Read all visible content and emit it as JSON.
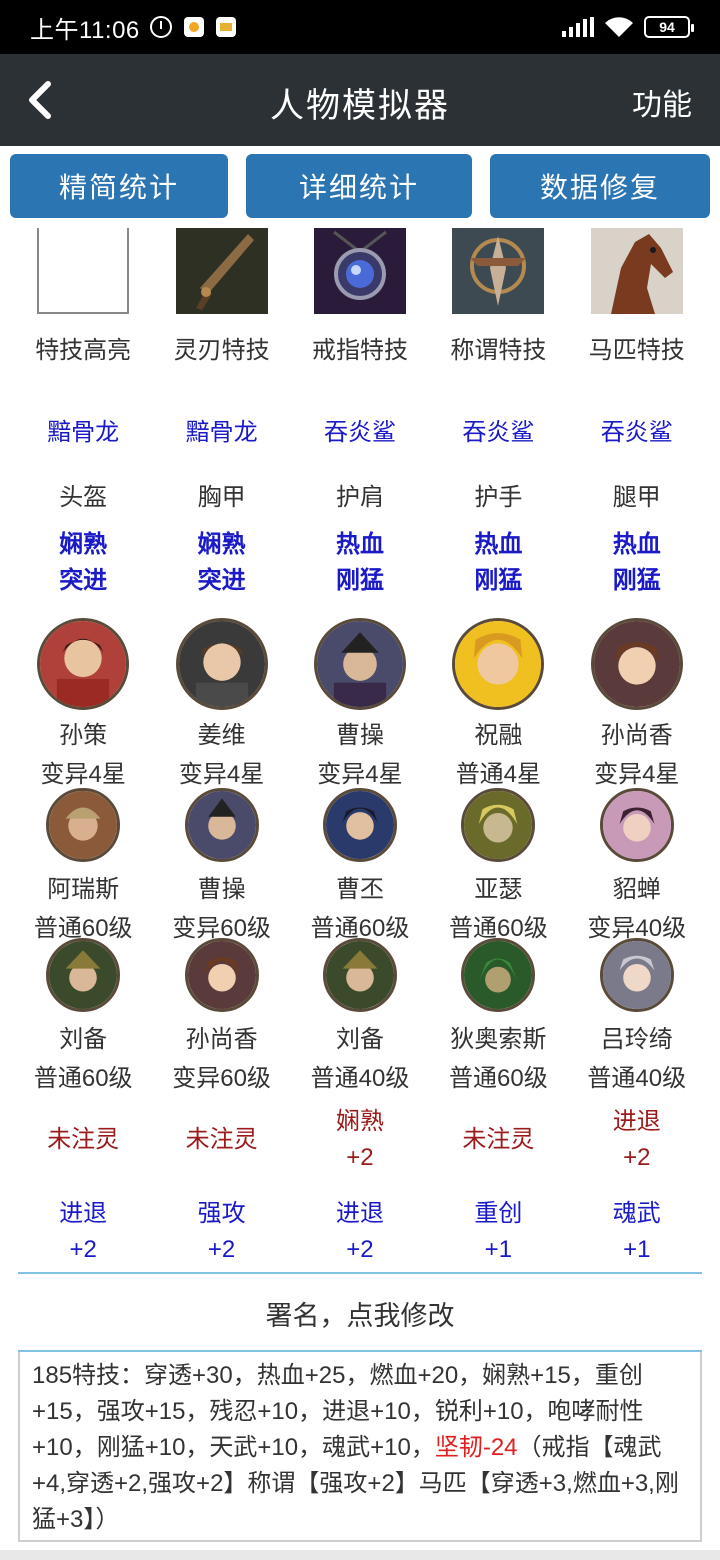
{
  "status_bar": {
    "time": "上午11:06",
    "battery": "94"
  },
  "header": {
    "title": "人物模拟器",
    "func": "功能"
  },
  "top_buttons": [
    "精简统计",
    "详细统计",
    "数据修复"
  ],
  "skills": [
    {
      "label": "特技高亮",
      "icon": "blank-frame"
    },
    {
      "label": "灵刃特技",
      "icon": "blade-icon"
    },
    {
      "label": "戒指特技",
      "icon": "ring-icon"
    },
    {
      "label": "称谓特技",
      "icon": "emblem-icon"
    },
    {
      "label": "马匹特技",
      "icon": "horse-icon"
    }
  ],
  "equip_sets": [
    "黯骨龙",
    "黯骨龙",
    "吞炎鲨",
    "吞炎鲨",
    "吞炎鲨"
  ],
  "equip_slots": [
    "头盔",
    "胸甲",
    "护肩",
    "护手",
    "腿甲"
  ],
  "equip_skills": [
    [
      "娴熟",
      "突进"
    ],
    [
      "娴熟",
      "突进"
    ],
    [
      "热血",
      "刚猛"
    ],
    [
      "热血",
      "刚猛"
    ],
    [
      "热血",
      "刚猛"
    ]
  ],
  "main_heroes": [
    {
      "name": "孙策",
      "level": "变异4星",
      "icon": "portrait-icon"
    },
    {
      "name": "姜维",
      "level": "变异4星",
      "icon": "portrait-icon"
    },
    {
      "name": "曹操",
      "level": "变异4星",
      "icon": "portrait-icon"
    },
    {
      "name": "祝融",
      "level": "普通4星",
      "icon": "portrait-icon"
    },
    {
      "name": "孙尚香",
      "level": "变异4星",
      "icon": "portrait-icon"
    }
  ],
  "support_row1": [
    {
      "name": "阿瑞斯",
      "level": "普通60级"
    },
    {
      "name": "曹操",
      "level": "变异60级"
    },
    {
      "name": "曹丕",
      "level": "普通60级"
    },
    {
      "name": "亚瑟",
      "level": "普通60级"
    },
    {
      "name": "貂蝉",
      "level": "变异40级"
    }
  ],
  "support_row2": [
    {
      "name": "刘备",
      "level": "普通60级"
    },
    {
      "name": "孙尚香",
      "level": "变异60级"
    },
    {
      "name": "刘备",
      "level": "普通40级"
    },
    {
      "name": "狄奥索斯",
      "level": "普通60级"
    },
    {
      "name": "吕玲绮",
      "level": "普通40级"
    }
  ],
  "spirit": [
    [
      "未注灵",
      ""
    ],
    [
      "未注灵",
      ""
    ],
    [
      "娴熟",
      "+2"
    ],
    [
      "未注灵",
      ""
    ],
    [
      "进退",
      "+2"
    ]
  ],
  "bonus": [
    [
      "进退",
      "+2"
    ],
    [
      "强攻",
      "+2"
    ],
    [
      "进退",
      "+2"
    ],
    [
      "重创",
      "+1"
    ],
    [
      "魂武",
      "+1"
    ]
  ],
  "signature": "署名，点我修改",
  "summary": {
    "part1": "185特技：穿透+30，热血+25，燃血+20，娴熟+15，重创+15，强攻+15，残忍+10，进退+10，锐利+10，咆哮耐性+10，刚猛+10，天武+10，魂武+10，",
    "highlight": "坚韧-24",
    "part2": "（戒指【魂武+4,穿透+2,强攻+2】称谓【强攻+2】马匹【穿透+3,燃血+3,刚猛+3】）"
  },
  "colors": {
    "header_bg": "#2b3134",
    "button_bg": "#2b75b3",
    "blue_text": "#1a1ac8",
    "red_text": "#b22222",
    "divider": "#7cc3e6"
  }
}
